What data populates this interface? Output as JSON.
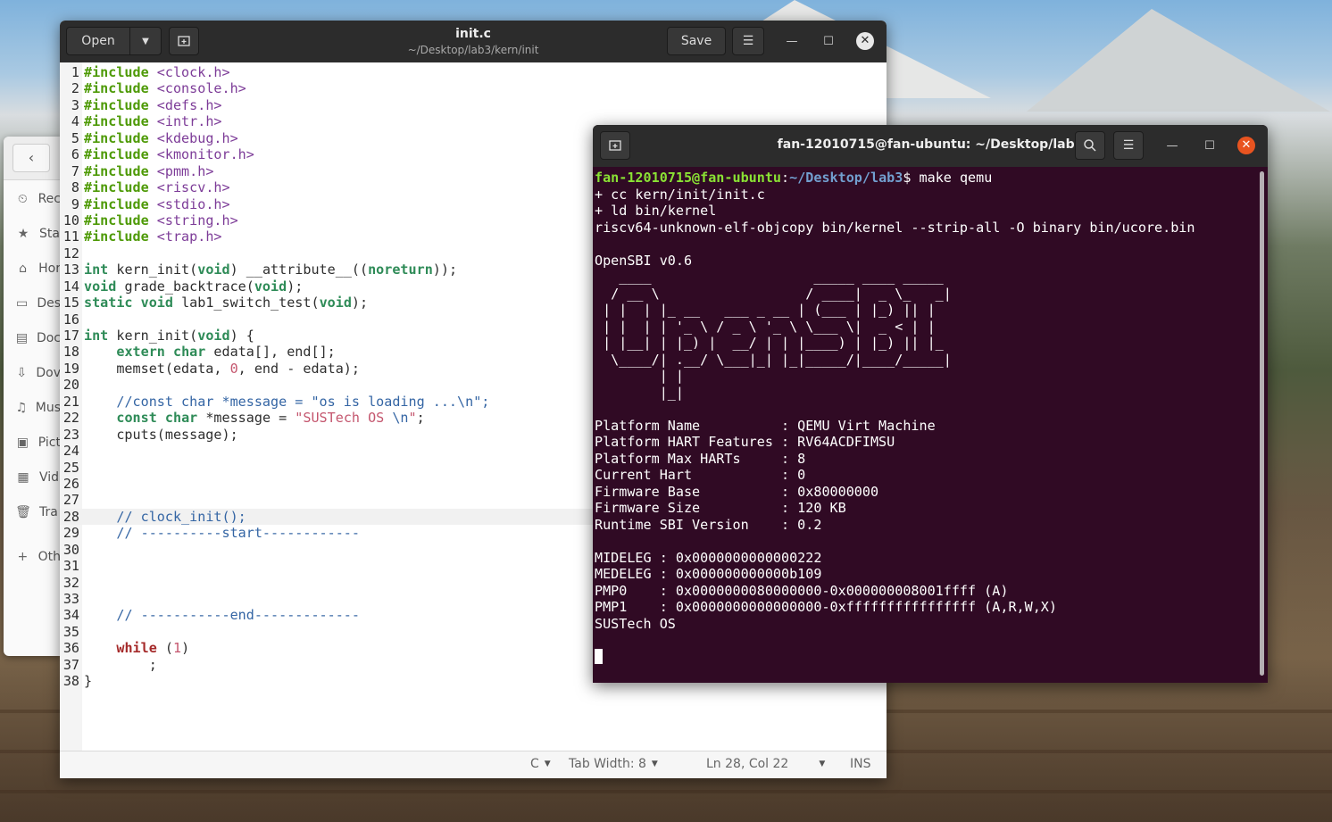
{
  "desktop": {
    "background": "mountain bridge wallpaper"
  },
  "files": {
    "back_icon": "‹",
    "items": [
      {
        "icon": "clock-icon",
        "glyph": "⏲",
        "label": "Rec"
      },
      {
        "icon": "star-icon",
        "glyph": "★",
        "label": "Sta"
      },
      {
        "icon": "home-icon",
        "glyph": "⌂",
        "label": "Hor"
      },
      {
        "icon": "desktop-icon",
        "glyph": "▭",
        "label": "Des"
      },
      {
        "icon": "document-icon",
        "glyph": "▤",
        "label": "Doc"
      },
      {
        "icon": "download-icon",
        "glyph": "⇩",
        "label": "Dov"
      },
      {
        "icon": "music-icon",
        "glyph": "♫",
        "label": "Mus"
      },
      {
        "icon": "picture-icon",
        "glyph": "▣",
        "label": "Pict"
      },
      {
        "icon": "video-icon",
        "glyph": "▦",
        "label": "Vid"
      },
      {
        "icon": "trash-icon",
        "glyph": "🗑",
        "label": "Tra"
      },
      {
        "icon": "plus-icon",
        "glyph": "+",
        "label": "Oth"
      }
    ]
  },
  "gedit": {
    "open_label": "Open",
    "save_label": "Save",
    "title": "init.c",
    "subtitle": "~/Desktop/lab3/kern/init",
    "status": {
      "language": "C",
      "tab_width": "Tab Width: 8",
      "position": "Ln 28, Col 22",
      "mode": "INS"
    },
    "lines": [
      {
        "n": "1",
        "segs": [
          [
            "k",
            "#include"
          ],
          [
            "",
            " "
          ],
          [
            "inc",
            "<clock.h>"
          ]
        ]
      },
      {
        "n": "2",
        "segs": [
          [
            "k",
            "#include"
          ],
          [
            "",
            " "
          ],
          [
            "inc",
            "<console.h>"
          ]
        ]
      },
      {
        "n": "3",
        "segs": [
          [
            "k",
            "#include"
          ],
          [
            "",
            " "
          ],
          [
            "inc",
            "<defs.h>"
          ]
        ]
      },
      {
        "n": "4",
        "segs": [
          [
            "k",
            "#include"
          ],
          [
            "",
            " "
          ],
          [
            "inc",
            "<intr.h>"
          ]
        ]
      },
      {
        "n": "5",
        "segs": [
          [
            "k",
            "#include"
          ],
          [
            "",
            " "
          ],
          [
            "inc",
            "<kdebug.h>"
          ]
        ]
      },
      {
        "n": "6",
        "segs": [
          [
            "k",
            "#include"
          ],
          [
            "",
            " "
          ],
          [
            "inc",
            "<kmonitor.h>"
          ]
        ]
      },
      {
        "n": "7",
        "segs": [
          [
            "k",
            "#include"
          ],
          [
            "",
            " "
          ],
          [
            "inc",
            "<pmm.h>"
          ]
        ]
      },
      {
        "n": "8",
        "segs": [
          [
            "k",
            "#include"
          ],
          [
            "",
            " "
          ],
          [
            "inc",
            "<riscv.h>"
          ]
        ]
      },
      {
        "n": "9",
        "segs": [
          [
            "k",
            "#include"
          ],
          [
            "",
            " "
          ],
          [
            "inc",
            "<stdio.h>"
          ]
        ]
      },
      {
        "n": "10",
        "segs": [
          [
            "k",
            "#include"
          ],
          [
            "",
            " "
          ],
          [
            "inc",
            "<string.h>"
          ]
        ]
      },
      {
        "n": "11",
        "segs": [
          [
            "k",
            "#include"
          ],
          [
            "",
            " "
          ],
          [
            "inc",
            "<trap.h>"
          ]
        ]
      },
      {
        "n": "12",
        "segs": []
      },
      {
        "n": "13",
        "segs": [
          [
            "typ",
            "int"
          ],
          [
            "",
            " kern_init("
          ],
          [
            "typ",
            "void"
          ],
          [
            "",
            ") __attribute__(("
          ],
          [
            "typ",
            "noreturn"
          ],
          [
            "",
            "));"
          ]
        ]
      },
      {
        "n": "14",
        "segs": [
          [
            "typ",
            "void"
          ],
          [
            "",
            " grade_backtrace("
          ],
          [
            "typ",
            "void"
          ],
          [
            "",
            ");"
          ]
        ]
      },
      {
        "n": "15",
        "segs": [
          [
            "typ",
            "static"
          ],
          [
            "",
            " "
          ],
          [
            "typ",
            "void"
          ],
          [
            "",
            " lab1_switch_test("
          ],
          [
            "typ",
            "void"
          ],
          [
            "",
            ");"
          ]
        ]
      },
      {
        "n": "16",
        "segs": []
      },
      {
        "n": "17",
        "segs": [
          [
            "typ",
            "int"
          ],
          [
            "",
            " kern_init("
          ],
          [
            "typ",
            "void"
          ],
          [
            "",
            ") {"
          ]
        ]
      },
      {
        "n": "18",
        "segs": [
          [
            "",
            "    "
          ],
          [
            "typ",
            "extern"
          ],
          [
            "",
            " "
          ],
          [
            "typ",
            "char"
          ],
          [
            "",
            " edata[], end[];"
          ]
        ]
      },
      {
        "n": "19",
        "segs": [
          [
            "",
            "    memset(edata, "
          ],
          [
            "num",
            "0"
          ],
          [
            "",
            ", end - edata);"
          ]
        ]
      },
      {
        "n": "20",
        "segs": []
      },
      {
        "n": "21",
        "segs": [
          [
            "",
            "    "
          ],
          [
            "cm",
            "//const char *message = \"os is loading ...\\n\";"
          ]
        ]
      },
      {
        "n": "22",
        "segs": [
          [
            "",
            "    "
          ],
          [
            "typ",
            "const"
          ],
          [
            "",
            " "
          ],
          [
            "typ",
            "char"
          ],
          [
            "",
            " *message = "
          ],
          [
            "str",
            "\"SUSTech OS "
          ],
          [
            "cm",
            "\\n"
          ],
          [
            "str",
            "\""
          ],
          [
            "",
            ";"
          ]
        ]
      },
      {
        "n": "23",
        "segs": [
          [
            "",
            "    cputs(message);"
          ]
        ]
      },
      {
        "n": "24",
        "segs": []
      },
      {
        "n": "25",
        "segs": []
      },
      {
        "n": "26",
        "segs": []
      },
      {
        "n": "27",
        "segs": []
      },
      {
        "n": "28",
        "segs": [
          [
            "",
            "    "
          ],
          [
            "cm",
            "// clock_init();"
          ]
        ],
        "current": true
      },
      {
        "n": "29",
        "segs": [
          [
            "",
            "    "
          ],
          [
            "cm",
            "// ----------start------------"
          ]
        ]
      },
      {
        "n": "30",
        "segs": []
      },
      {
        "n": "31",
        "segs": []
      },
      {
        "n": "32",
        "segs": []
      },
      {
        "n": "33",
        "segs": []
      },
      {
        "n": "34",
        "segs": [
          [
            "",
            "    "
          ],
          [
            "cm",
            "// -----------end-------------"
          ]
        ]
      },
      {
        "n": "35",
        "segs": []
      },
      {
        "n": "36",
        "segs": [
          [
            "",
            "    "
          ],
          [
            "kw",
            "while"
          ],
          [
            "",
            " ("
          ],
          [
            "num",
            "1"
          ],
          [
            "",
            ")"
          ]
        ]
      },
      {
        "n": "37",
        "segs": [
          [
            "",
            "        ;"
          ]
        ]
      },
      {
        "n": "38",
        "segs": [
          [
            "",
            "}"
          ]
        ]
      }
    ]
  },
  "terminal": {
    "title": "fan-12010715@fan-ubuntu: ~/Desktop/lab3",
    "prompt_user": "fan-12010715@fan-ubuntu",
    "prompt_path": "~/Desktop/lab3",
    "command": "make qemu",
    "output": [
      "+ cc kern/init/init.c",
      "+ ld bin/kernel",
      "riscv64-unknown-elf-objcopy bin/kernel --strip-all -O binary bin/ucore.bin",
      "",
      "OpenSBI v0.6",
      "   ____                    _____ ____ _____",
      "  / __ \\                  / ____|  _ \\_   _|",
      " | |  | |_ __   ___ _ __ | (___ | |_) || |",
      " | |  | | '_ \\ / _ \\ '_ \\ \\___ \\|  _ < | |",
      " | |__| | |_) |  __/ | | |____) | |_) || |_",
      "  \\____/| .__/ \\___|_| |_|_____/|____/_____|",
      "        | |",
      "        |_|",
      "",
      "Platform Name          : QEMU Virt Machine",
      "Platform HART Features : RV64ACDFIMSU",
      "Platform Max HARTs     : 8",
      "Current Hart           : 0",
      "Firmware Base          : 0x80000000",
      "Firmware Size          : 120 KB",
      "Runtime SBI Version    : 0.2",
      "",
      "MIDELEG : 0x0000000000000222",
      "MEDELEG : 0x000000000000b109",
      "PMP0    : 0x0000000080000000-0x000000008001ffff (A)",
      "PMP1    : 0x0000000000000000-0xffffffffffffffff (A,R,W,X)",
      "SUSTech OS",
      ""
    ]
  }
}
